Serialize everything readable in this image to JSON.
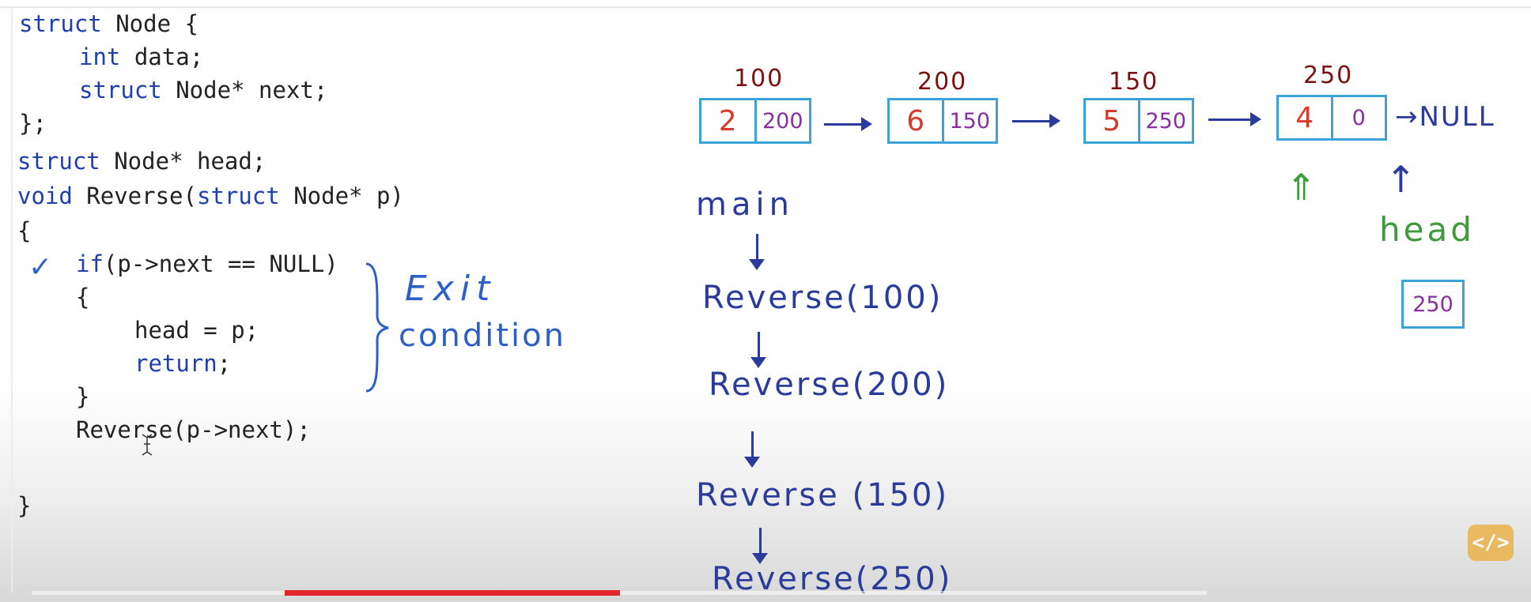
{
  "code": {
    "lines": [
      {
        "kw": "struct",
        "rest": " Node {"
      },
      {
        "kw": "int",
        "rest": " data;"
      },
      {
        "kw": "struct",
        "rest": " Node* next;"
      },
      {
        "kw": "",
        "rest": "};"
      },
      {
        "kw": "struct",
        "rest": " Node* head;"
      },
      {
        "kw": "void",
        "rest": " Reverse("
      },
      {
        "kw": "struct",
        "rest": " Node* p)"
      },
      {
        "kw": "",
        "rest": "{"
      },
      {
        "kw": "if",
        "rest": "(p->next == NULL)"
      },
      {
        "kw": "",
        "rest": "{"
      },
      {
        "kw": "",
        "rest": "head = p;"
      },
      {
        "kw": "return",
        "rest": ";"
      },
      {
        "kw": "",
        "rest": "}"
      },
      {
        "kw": "",
        "rest": "Reverse(p->next);"
      },
      {
        "kw": "",
        "rest": "}"
      }
    ],
    "checkmark": "✓",
    "annotation_line1": "Exit",
    "annotation_line2": "condition"
  },
  "diagram": {
    "nodes": [
      {
        "address": "100",
        "value": "2",
        "next": "200"
      },
      {
        "address": "200",
        "value": "6",
        "next": "150"
      },
      {
        "address": "150",
        "value": "5",
        "next": "250"
      },
      {
        "address": "250",
        "value": "4",
        "next": "0"
      }
    ],
    "null_label": "→NULL",
    "p_marker": "⇑",
    "head_arrow": "↑",
    "head_label": "head",
    "head_value": "250"
  },
  "call_stack": {
    "main_label": "main",
    "calls": [
      "Reverse(100)",
      "Reverse(200)",
      "Reverse (150)",
      "Reverse(250)"
    ]
  },
  "player": {
    "progress": 0.4,
    "icon": "code-brackets-icon",
    "icon_glyph": "</>"
  },
  "colors": {
    "keyword": "#1f3fb0",
    "handwriting_blue": "#2d5fc8",
    "handwriting_navy": "#2b3b9c",
    "value_red": "#d83a2a",
    "pointer_purple": "#8a2ea0",
    "address_maroon": "#7a1010",
    "node_border": "#3aa3d9",
    "marker_green": "#3e9a3c",
    "progress_red": "#e0262b"
  }
}
